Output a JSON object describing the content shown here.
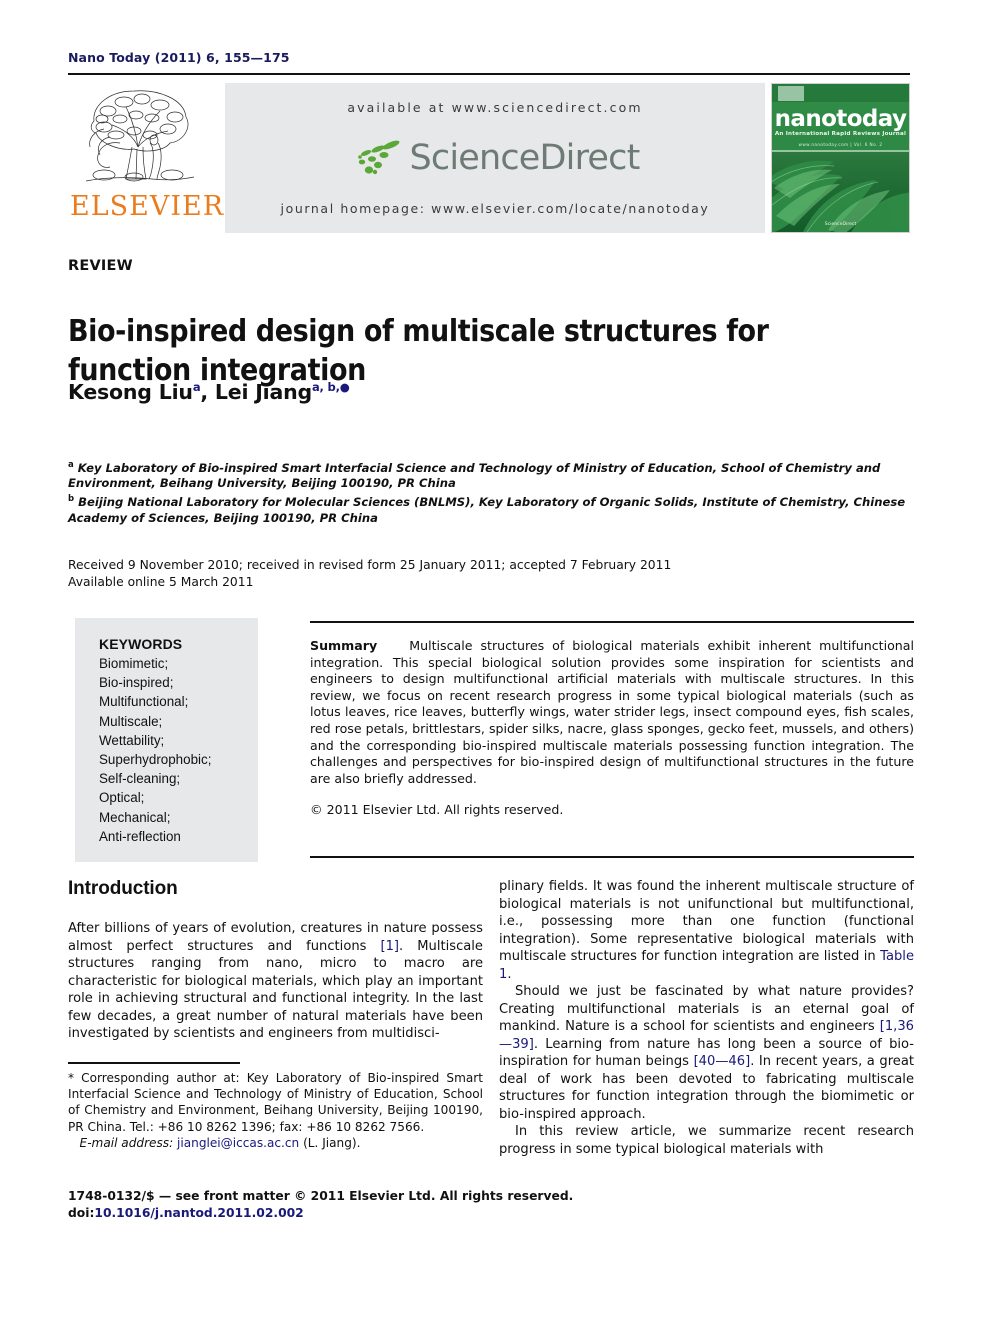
{
  "running_head": "Nano Today (2011) 6, 155—175",
  "masthead": {
    "publisher_name": "ELSEVIER",
    "available_at": "available at www.sciencedirect.com",
    "sciencedirect_name": "ScienceDirect",
    "journal_homepage": "journal homepage: www.elsevier.com/locate/nanotoday",
    "cover": {
      "title": "nanotoday",
      "subtitle": "An International Rapid Reviews Journal",
      "subtitle2": "www.nanotoday.com   |   Vol. 6   No. 2",
      "footer": "ScienceDirect"
    }
  },
  "article": {
    "type_label": "REVIEW",
    "title": "Bio-inspired design of multiscale structures for function integration",
    "authors": [
      {
        "name": "Kesong Liu",
        "sup": "a"
      },
      {
        "name": "Lei Jiang",
        "sup": "a, b,"
      }
    ],
    "affiliations": [
      {
        "marker": "a",
        "text": "Key Laboratory of Bio-inspired Smart Interfacial Science and Technology of Ministry of Education, School of Chemistry and Environment, Beihang University, Beijing 100190, PR China"
      },
      {
        "marker": "b",
        "text": "Beijing National Laboratory for Molecular Sciences (BNLMS), Key Laboratory of Organic Solids, Institute of Chemistry, Chinese Academy of Sciences, Beijing 100190, PR China"
      }
    ],
    "history_line1": "Received 9 November 2010; received in revised form 25 January 2011; accepted 7 February 2011",
    "history_line2": "Available online 5 March 2011"
  },
  "keywords": {
    "heading": "KEYWORDS",
    "items": [
      "Biomimetic;",
      "Bio-inspired;",
      "Multifunctional;",
      "Multiscale;",
      "Wettability;",
      "Superhydrophobic;",
      "Self-cleaning;",
      "Optical;",
      "Mechanical;",
      "Anti-reflection"
    ]
  },
  "summary": {
    "label": "Summary",
    "text": "Multiscale structures of biological materials exhibit inherent multifunctional integration. This special biological solution provides some inspiration for scientists and engineers to design multifunctional artificial materials with multiscale structures. In this review, we focus on recent research progress in some typical biological materials (such as lotus leaves, rice leaves, butterfly wings, water strider legs, insect compound eyes, fish scales, red rose petals, brittlestars, spider silks, nacre, glass sponges, gecko feet, mussels, and others) and the corresponding bio-inspired multiscale materials possessing function integration. The challenges and perspectives for bio-inspired design of multifunctional structures in the future are also briefly addressed.",
    "copyright": "© 2011 Elsevier Ltd. All rights reserved."
  },
  "body": {
    "section_heading": "Introduction",
    "left_column": {
      "para1_a": "After billions of years of evolution, creatures in nature possess almost perfect structures and functions ",
      "para1_ref": "[1]",
      "para1_b": ". Multiscale structures ranging from nano, micro to macro are characteristic for biological materials, which play an important role in achieving structural and functional integrity. In the last few decades, a great number of natural materials have been investigated by scientists and engineers from multidisci-"
    },
    "right_column": {
      "para1": "plinary fields. It was found the inherent multiscale structure of biological materials is not unifunctional but multifunctional, i.e., possessing more than one function (functional integration). Some representative biological materials with multiscale structures for function integration are listed in ",
      "para1_ref": "Table 1",
      "para1_end": ".",
      "para2_a": "Should we just be fascinated by what nature provides? Creating multifunctional materials is an eternal goal of mankind. Nature is a school for scientists and engineers ",
      "para2_ref1": "[1,36—39]",
      "para2_b": ". Learning from nature has long been a source of bio-inspiration for human beings ",
      "para2_ref2": "[40—46]",
      "para2_c": ". In recent years, a great deal of work has been devoted to fabricating multiscale structures for function integration through the biomimetic or bio-inspired approach.",
      "para3": "In this review article, we summarize recent research progress in some typical biological materials with"
    }
  },
  "footnote": {
    "corresponding": "* Corresponding author at: Key Laboratory of Bio-inspired Smart Interfacial Science and Technology of Ministry of Education, School of Chemistry and Environment, Beihang University, Beijing 100190, PR China. Tel.: +86 10 8262 1396; fax: +86 10 8262 7566.",
    "email_label": "E-mail address:",
    "email": "jianglei@iccas.ac.cn",
    "email_suffix": "(L. Jiang)."
  },
  "footer": {
    "issn_line": "1748-0132/$ — see front matter © 2011 Elsevier Ltd. All rights reserved.",
    "doi_prefix": "doi:",
    "doi": "10.1016/j.nantod.2011.02.002"
  },
  "colors": {
    "accent_orange": "#eb7c1e",
    "link_blue": "#19197a",
    "band_gray": "#e7e8ea",
    "cover_green": "#2f7d46",
    "sd_gray": "#6e7b74"
  }
}
